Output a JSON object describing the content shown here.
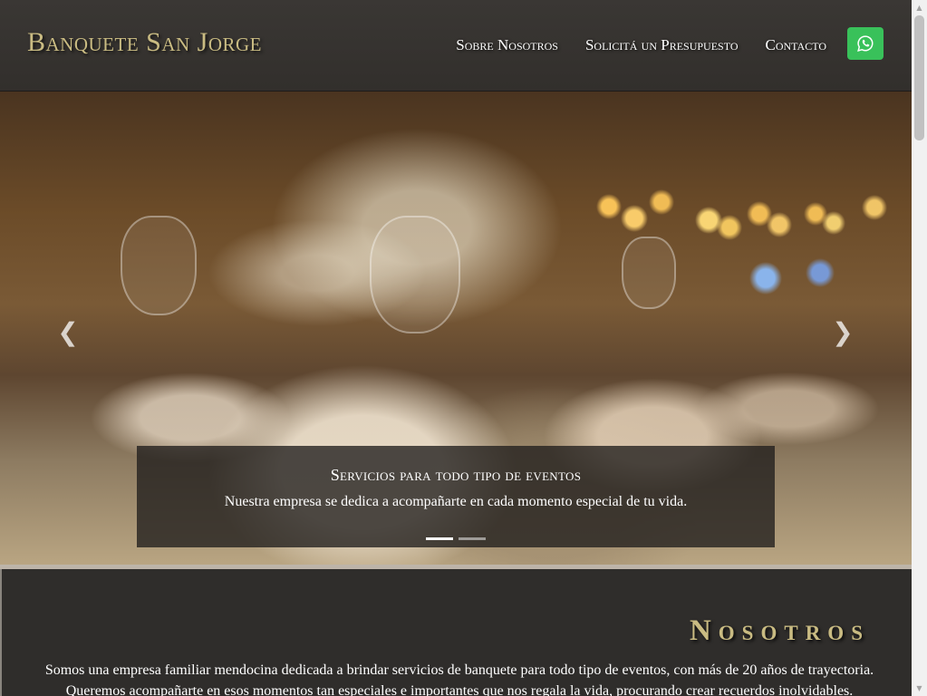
{
  "header": {
    "brand": "Banquete San Jorge",
    "nav": [
      "Sobre Nosotros",
      "Solicitá un Presupuesto",
      "Contacto"
    ],
    "whatsapp_icon": "whatsapp-icon",
    "whatsapp_color": "#39c15a"
  },
  "hero": {
    "prev_icon": "chevron-left-icon",
    "next_icon": "chevron-right-icon",
    "prev_glyph": "❮",
    "next_glyph": "❯",
    "caption": {
      "title": "Servicios para todo tipo de eventos",
      "text": "Nuestra empresa se dedica a acompañarte en cada momento especial de tu vida."
    },
    "slides_total": 2,
    "active_slide": 1
  },
  "about": {
    "title": "Nosotros",
    "text": "Somos una empresa familiar mendocina dedicada a brindar servicios de banquete para todo tipo de eventos, con más de 20 años de trayectoria. Queremos acompañarte en esos momentos tan especiales e importantes que nos regala la vida, procurando crear recuerdos inolvidables."
  },
  "colors": {
    "brand_gold": "#c9bb82",
    "header_bg": "#3a3734",
    "section_bg": "#2f2d2b"
  }
}
